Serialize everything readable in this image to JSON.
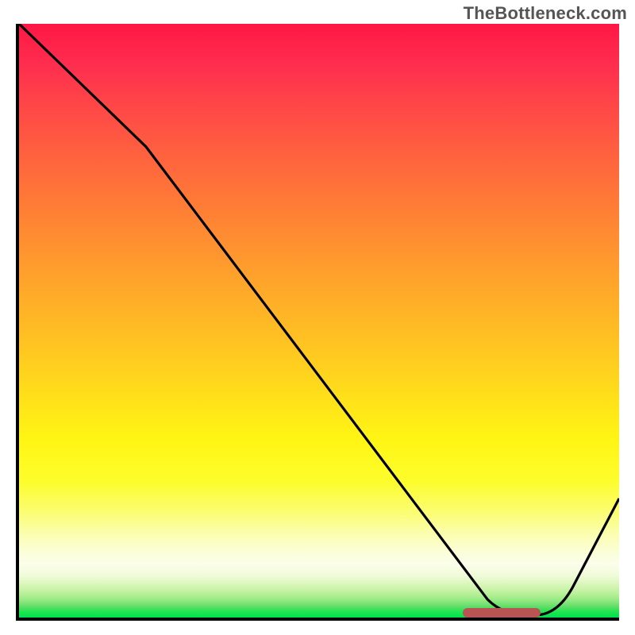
{
  "watermark": "TheBottleneck.com",
  "chart_data": {
    "type": "line",
    "title": "",
    "xlabel": "",
    "ylabel": "",
    "xlim": [
      0,
      100
    ],
    "ylim": [
      0,
      100
    ],
    "x": [
      0,
      21,
      78,
      85,
      86,
      89,
      92,
      100
    ],
    "values": [
      100,
      79,
      3,
      0.5,
      0.5,
      0.5,
      5.7,
      20
    ],
    "background_gradient_stops": [
      {
        "pos": 0.0,
        "color": "#ff1744"
      },
      {
        "pos": 0.35,
        "color": "#ff8a32"
      },
      {
        "pos": 0.7,
        "color": "#fff514"
      },
      {
        "pos": 0.89,
        "color": "#fbfeea"
      },
      {
        "pos": 1.0,
        "color": "#00e050"
      }
    ],
    "optimal_zone": {
      "x_start": 74,
      "x_end": 87,
      "color": "#b85454"
    },
    "annotations": []
  }
}
